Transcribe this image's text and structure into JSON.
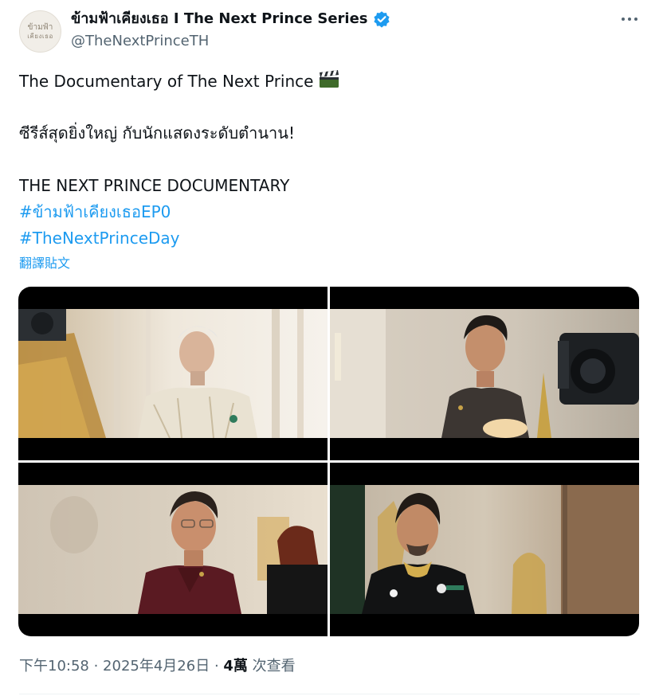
{
  "author": {
    "display_name": "ข้ามฟ้าเคียงเธอ I The Next Prince Series",
    "handle": "@TheNextPrinceTH",
    "avatar_logo_line1": "ข้ามฟ้า",
    "avatar_logo_line2": "เคียงเธอ",
    "verified_icon": "verified-badge-icon",
    "badge_color": "#1d9bf0"
  },
  "tweet": {
    "line1": "The Documentary of The Next Prince",
    "line1_emoji_icon": "clapper-board-icon",
    "line2": "ซีรีส์สุดยิ่งใหญ่ กับนักแสดงระดับตำนาน!",
    "line3": "THE NEXT PRINCE DOCUMENTARY",
    "hashtag1": "#ข้ามฟ้าเคียงเธอEP0",
    "hashtag2": "#TheNextPrinceDay",
    "translate_label": "翻譯貼文",
    "link_color": "#1d9bf0"
  },
  "media": {
    "count": 4,
    "items": [
      {
        "icon": "photo-elder-man-white-costume"
      },
      {
        "icon": "photo-man-dark-uniform"
      },
      {
        "icon": "photo-man-glasses-maroon"
      },
      {
        "icon": "photo-man-black-gold-uniform"
      }
    ]
  },
  "footer": {
    "time": "下午10:58",
    "separator": " · ",
    "date": "2025年4月26日",
    "views_count": "4萬",
    "views_label": "次查看"
  }
}
